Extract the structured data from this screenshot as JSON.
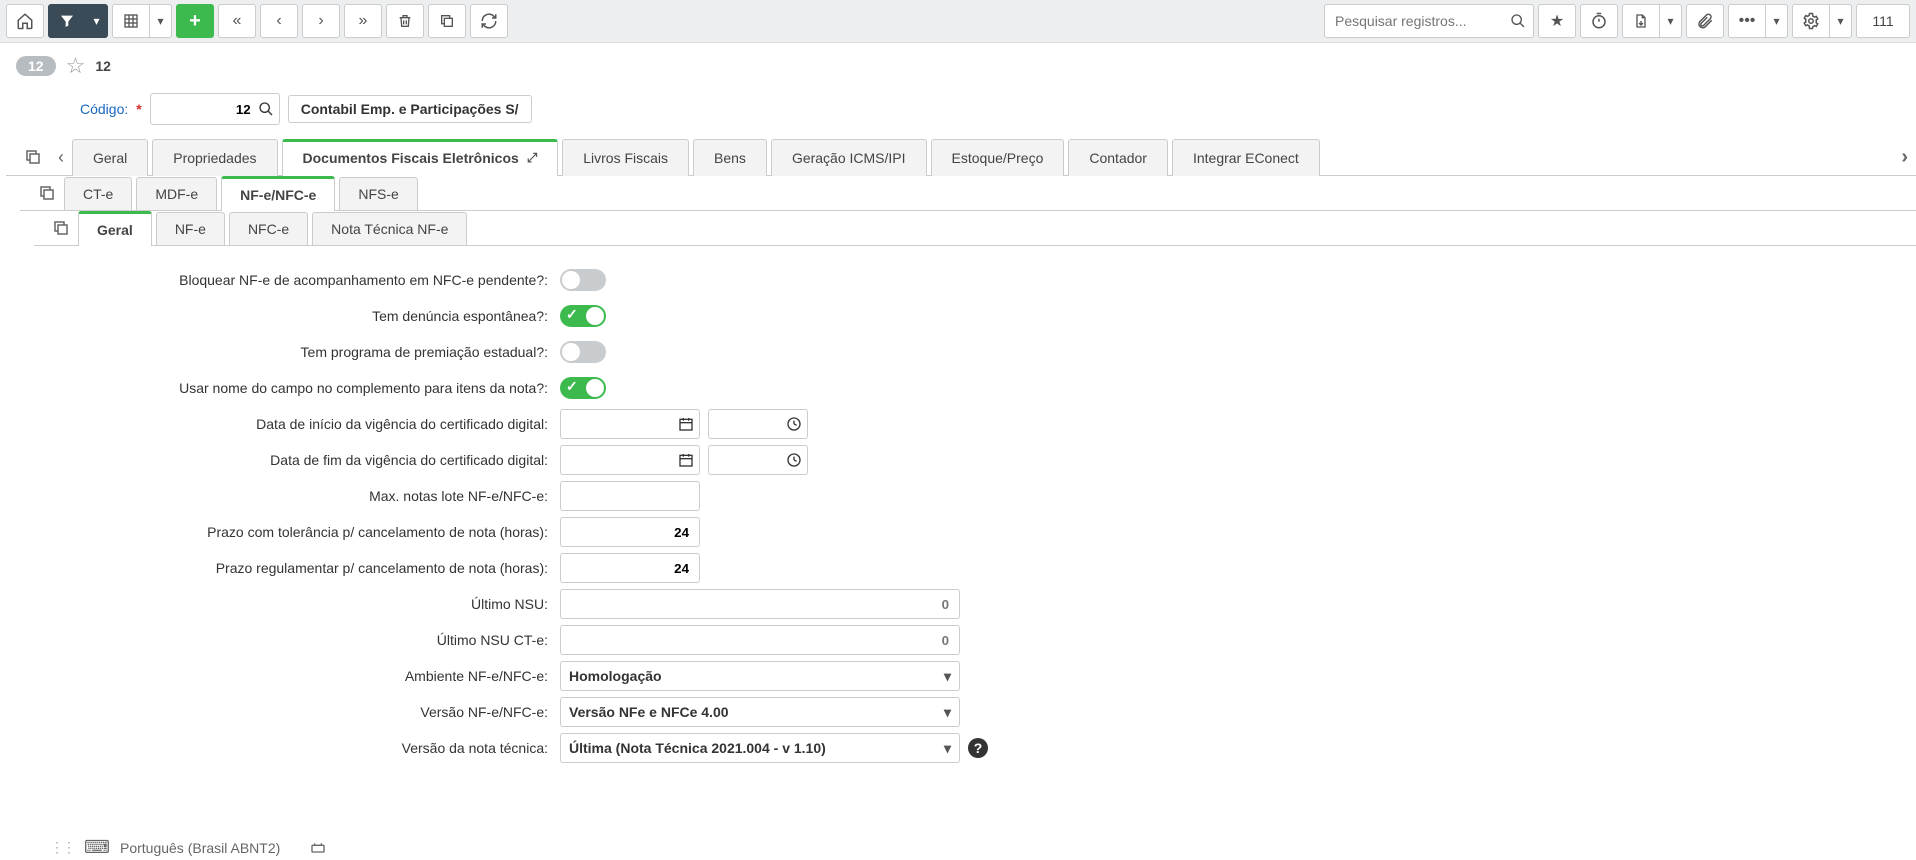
{
  "toolbar": {
    "search_placeholder": "Pesquisar registros...",
    "count": "111"
  },
  "breadcrumb": {
    "id_badge": "12",
    "star_count": "12"
  },
  "header": {
    "code_label": "Código:",
    "code_value": "12",
    "name_value": "Contabil Emp. e Participações S/"
  },
  "tabs_l1": [
    "Geral",
    "Propriedades",
    "Documentos Fiscais Eletrônicos",
    "Livros Fiscais",
    "Bens",
    "Geração ICMS/IPI",
    "Estoque/Preço",
    "Contador",
    "Integrar EConect"
  ],
  "tabs_l2": [
    "CT-e",
    "MDF-e",
    "NF-e/NFC-e",
    "NFS-e"
  ],
  "tabs_l3": [
    "Geral",
    "NF-e",
    "NFC-e",
    "Nota Técnica NF-e"
  ],
  "form": {
    "block_nfe_label": "Bloquear NF-e de acompanhamento em NFC-e pendente?:",
    "denuncia_label": "Tem denúncia espontânea?:",
    "premiacao_label": "Tem programa de premiação estadual?:",
    "usar_nome_label": "Usar nome do campo no complemento para itens da nota?:",
    "inicio_cert_label": "Data de início da vigência do certificado digital:",
    "fim_cert_label": "Data de fim da vigência do certificado digital:",
    "max_notas_label": "Max. notas lote NF-e/NFC-e:",
    "prazo_tol_label": "Prazo com tolerância p/ cancelamento de nota (horas):",
    "prazo_tol_value": "24",
    "prazo_reg_label": "Prazo regulamentar p/ cancelamento de nota (horas):",
    "prazo_reg_value": "24",
    "ultimo_nsu_label": "Último NSU:",
    "ultimo_nsu_value": "0",
    "ultimo_nsu_cte_label": "Último NSU CT-e:",
    "ultimo_nsu_cte_value": "0",
    "ambiente_label": "Ambiente NF-e/NFC-e:",
    "ambiente_value": "Homologação",
    "versao_label": "Versão NF-e/NFC-e:",
    "versao_value": "Versão NFe e NFCe 4.00",
    "nota_tecnica_label": "Versão da nota técnica:",
    "nota_tecnica_value": "Última (Nota Técnica 2021.004 - v 1.10)"
  },
  "footer": {
    "locale": "Português (Brasil ABNT2)"
  }
}
